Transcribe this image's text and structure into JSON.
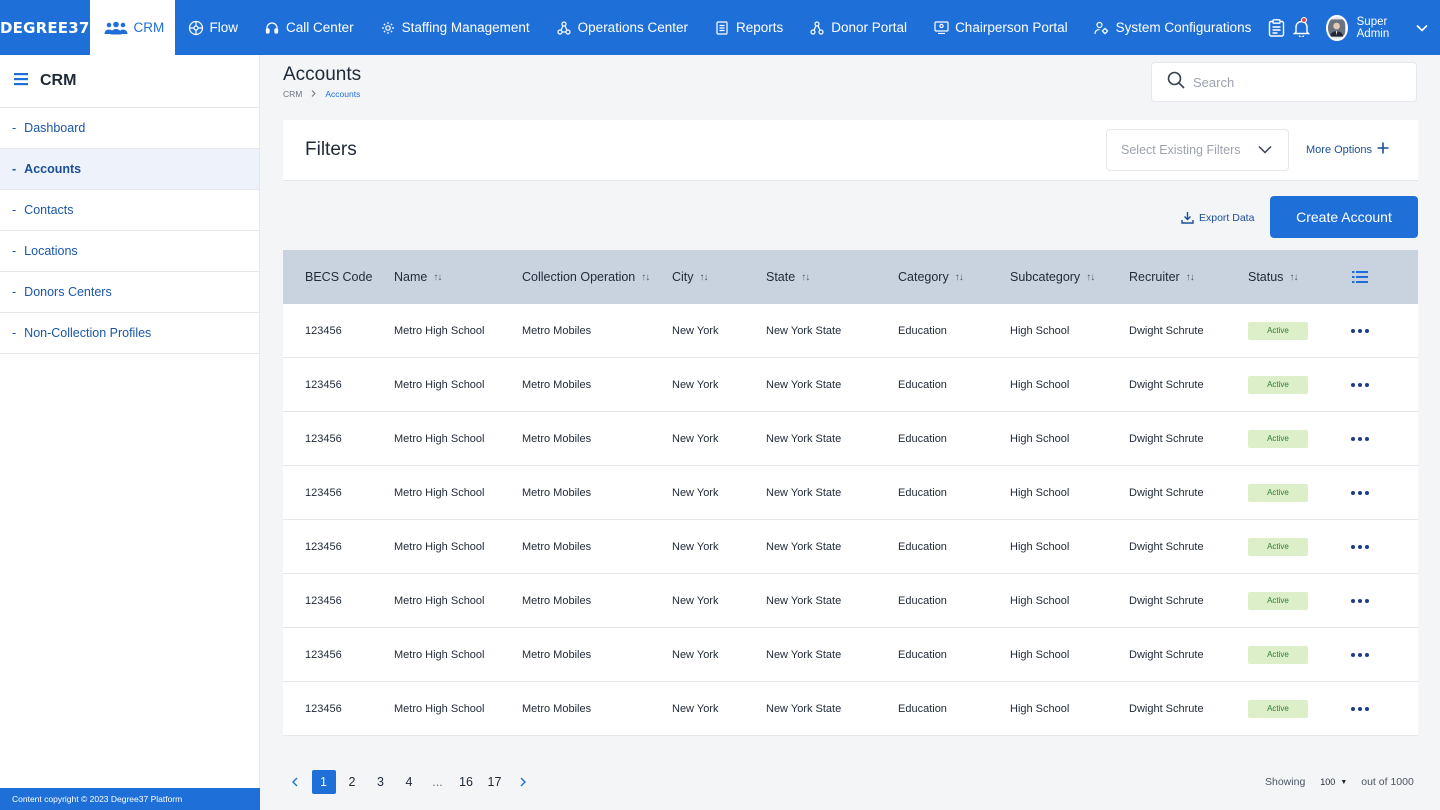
{
  "brand": "DEGREE37",
  "nav": {
    "items": [
      {
        "label": "CRM",
        "icon": "people-icon",
        "active": true
      },
      {
        "label": "Flow",
        "icon": "flow-icon"
      },
      {
        "label": "Call Center",
        "icon": "headset-icon"
      },
      {
        "label": "Staffing Management",
        "icon": "staffing-icon"
      },
      {
        "label": "Operations Center",
        "icon": "operations-icon"
      },
      {
        "label": "Reports",
        "icon": "report-icon"
      },
      {
        "label": "Donor Portal",
        "icon": "donor-icon"
      },
      {
        "label": "Chairperson Portal",
        "icon": "chairperson-icon"
      },
      {
        "label": "System Configurations",
        "icon": "config-icon"
      }
    ],
    "user_name": "Super Admin"
  },
  "sidebar": {
    "title": "CRM",
    "items": [
      {
        "label": "Dashboard"
      },
      {
        "label": "Accounts",
        "active": true
      },
      {
        "label": "Contacts"
      },
      {
        "label": "Locations"
      },
      {
        "label": "Donors Centers"
      },
      {
        "label": "Non-Collection Profiles"
      }
    ],
    "footer": "Content copyright © 2023 Degree37 Platform"
  },
  "page": {
    "title": "Accounts",
    "breadcrumb": [
      "CRM",
      "Accounts"
    ],
    "search_placeholder": "Search"
  },
  "filters": {
    "title": "Filters",
    "select_placeholder": "Select Existing Filters",
    "more_options": "More Options"
  },
  "actions": {
    "export": "Export Data",
    "create": "Create Account"
  },
  "table": {
    "columns": [
      "BECS Code",
      "Name",
      "Collection Operation",
      "City",
      "State",
      "Category",
      "Subcategory",
      "Recruiter",
      "Status"
    ],
    "rows": [
      [
        "123456",
        "Metro High School",
        "Metro Mobiles",
        "New York",
        "New York State",
        "Education",
        "High School",
        "Dwight Schrute",
        "Active"
      ],
      [
        "123456",
        "Metro High School",
        "Metro Mobiles",
        "New York",
        "New York State",
        "Education",
        "High School",
        "Dwight Schrute",
        "Active"
      ],
      [
        "123456",
        "Metro High School",
        "Metro Mobiles",
        "New York",
        "New York State",
        "Education",
        "High School",
        "Dwight Schrute",
        "Active"
      ],
      [
        "123456",
        "Metro High School",
        "Metro Mobiles",
        "New York",
        "New York State",
        "Education",
        "High School",
        "Dwight Schrute",
        "Active"
      ],
      [
        "123456",
        "Metro High School",
        "Metro Mobiles",
        "New York",
        "New York State",
        "Education",
        "High School",
        "Dwight Schrute",
        "Active"
      ],
      [
        "123456",
        "Metro High School",
        "Metro Mobiles",
        "New York",
        "New York State",
        "Education",
        "High School",
        "Dwight Schrute",
        "Active"
      ],
      [
        "123456",
        "Metro High School",
        "Metro Mobiles",
        "New York",
        "New York State",
        "Education",
        "High School",
        "Dwight Schrute",
        "Active"
      ],
      [
        "123456",
        "Metro High School",
        "Metro Mobiles",
        "New York",
        "New York State",
        "Education",
        "High School",
        "Dwight Schrute",
        "Active"
      ]
    ]
  },
  "pagination": {
    "pages": [
      "1",
      "2",
      "3",
      "4",
      "...",
      "16",
      "17"
    ],
    "current": "1",
    "showing_label": "Showing",
    "page_size": "100",
    "total": "out of 1000"
  },
  "colors": {
    "primary": "#1f6fd8",
    "table_header": "#c9d3e0",
    "status_active_bg": "#dcefc9",
    "status_active_text": "#2e7d32"
  }
}
